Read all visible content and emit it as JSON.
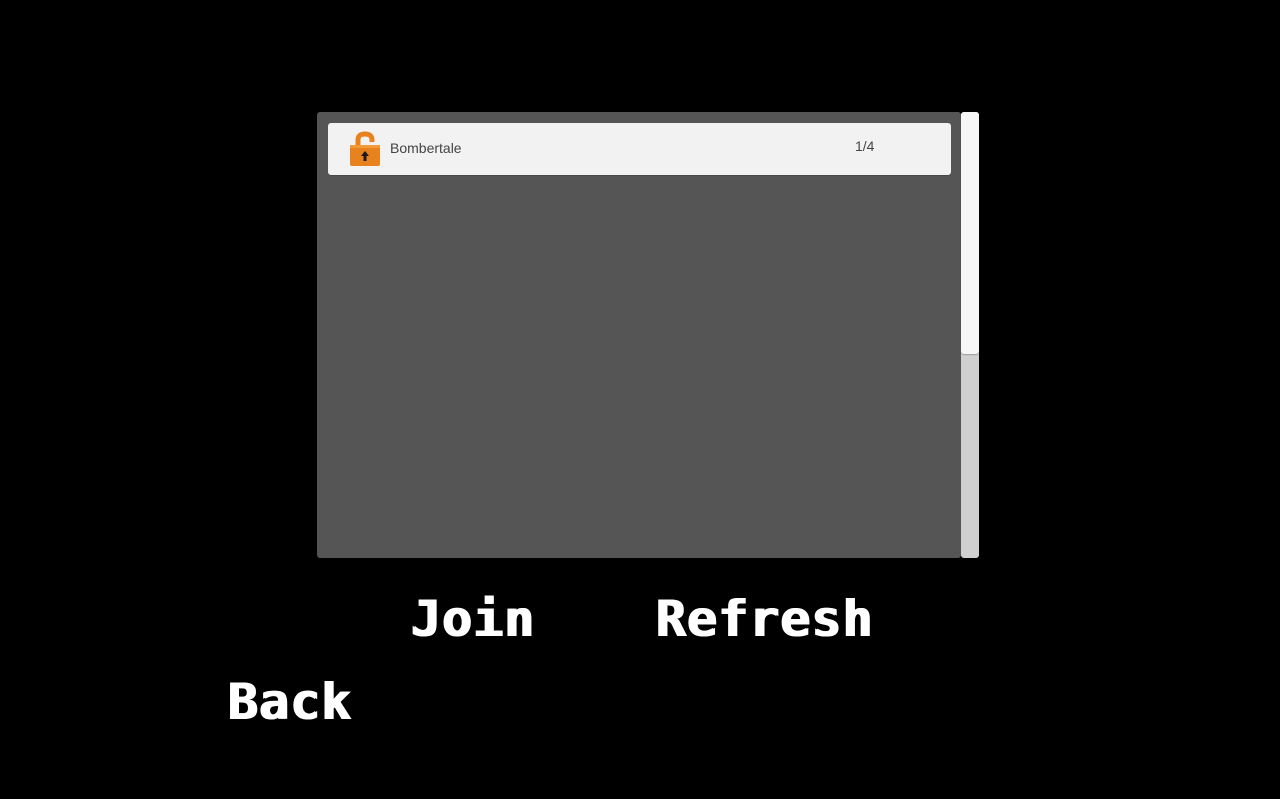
{
  "server_list": {
    "rows": [
      {
        "name": "Bombertale",
        "players": "1/4",
        "icon": "unlocked-padlock-icon"
      }
    ]
  },
  "buttons": {
    "join": "Join",
    "refresh": "Refresh",
    "back": "Back"
  },
  "colors": {
    "background": "#000000",
    "panel": "#555555",
    "row": "#f2f2f2",
    "lock_orange": "#e8821e",
    "text": "#444444",
    "button_text": "#ffffff"
  }
}
